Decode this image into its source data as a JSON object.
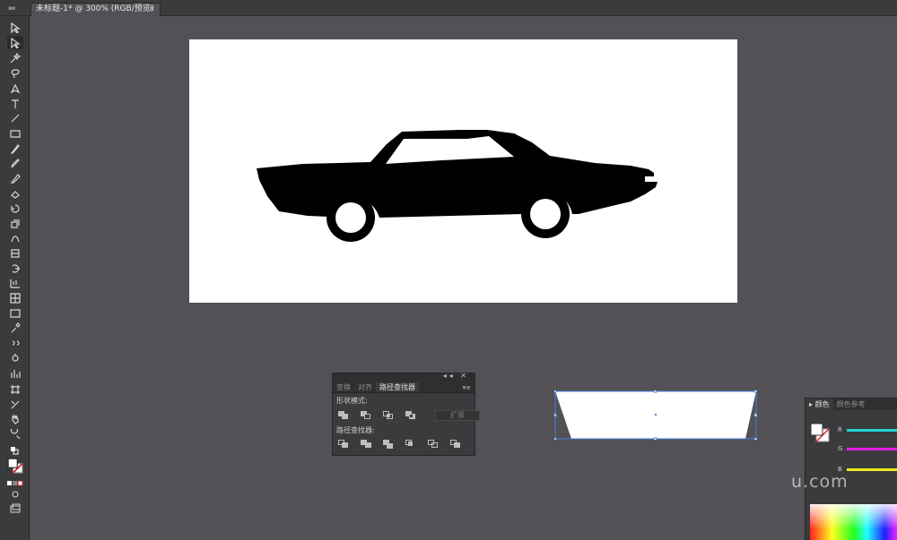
{
  "document_tab": {
    "title": "未标题-1* @ 300% (RGB/预览)",
    "close": "×"
  },
  "toolbar": {
    "tools": [
      "selection-tool-icon",
      "direct-selection-tool-icon",
      "magic-wand-tool-icon",
      "lasso-tool-icon",
      "pen-tool-icon",
      "type-tool-icon",
      "line-segment-tool-icon",
      "rectangle-tool-icon",
      "paintbrush-tool-icon",
      "pencil-tool-icon",
      "blob-brush-tool-icon",
      "eraser-tool-icon",
      "rotate-tool-icon",
      "scale-tool-icon",
      "warp-tool-icon",
      "free-transform-tool-icon",
      "shape-builder-tool-icon",
      "perspective-grid-tool-icon",
      "mesh-tool-icon",
      "gradient-tool-icon",
      "eyedropper-tool-icon",
      "blend-tool-icon",
      "symbol-sprayer-tool-icon",
      "column-graph-tool-icon",
      "artboard-tool-icon",
      "slice-tool-icon",
      "hand-tool-icon",
      "zoom-tool-icon"
    ]
  },
  "pathfinder_panel": {
    "tabs": [
      "变换",
      "对齐",
      "路径查找器"
    ],
    "active_tab": "路径查找器",
    "shape_modes_label": "形状模式:",
    "expand_button": "扩展",
    "pathfinders_label": "路径查找器:",
    "collapse_controls": "◂◂ ✕",
    "menu_icon": "▾≡"
  },
  "color_panel": {
    "tabs": [
      "颜色",
      "颜色参考"
    ],
    "active_tab": "颜色",
    "channels": [
      {
        "label": "R",
        "color": "#22d3d3"
      },
      {
        "label": "G",
        "color": "#e020e0"
      },
      {
        "label": "B",
        "color": "#e8e820"
      }
    ]
  },
  "watermark": "u.com",
  "colors": {
    "background": "#535155",
    "panel": "#3b3a3c",
    "selection": "#4a7fd6",
    "artwork": "#000000"
  }
}
